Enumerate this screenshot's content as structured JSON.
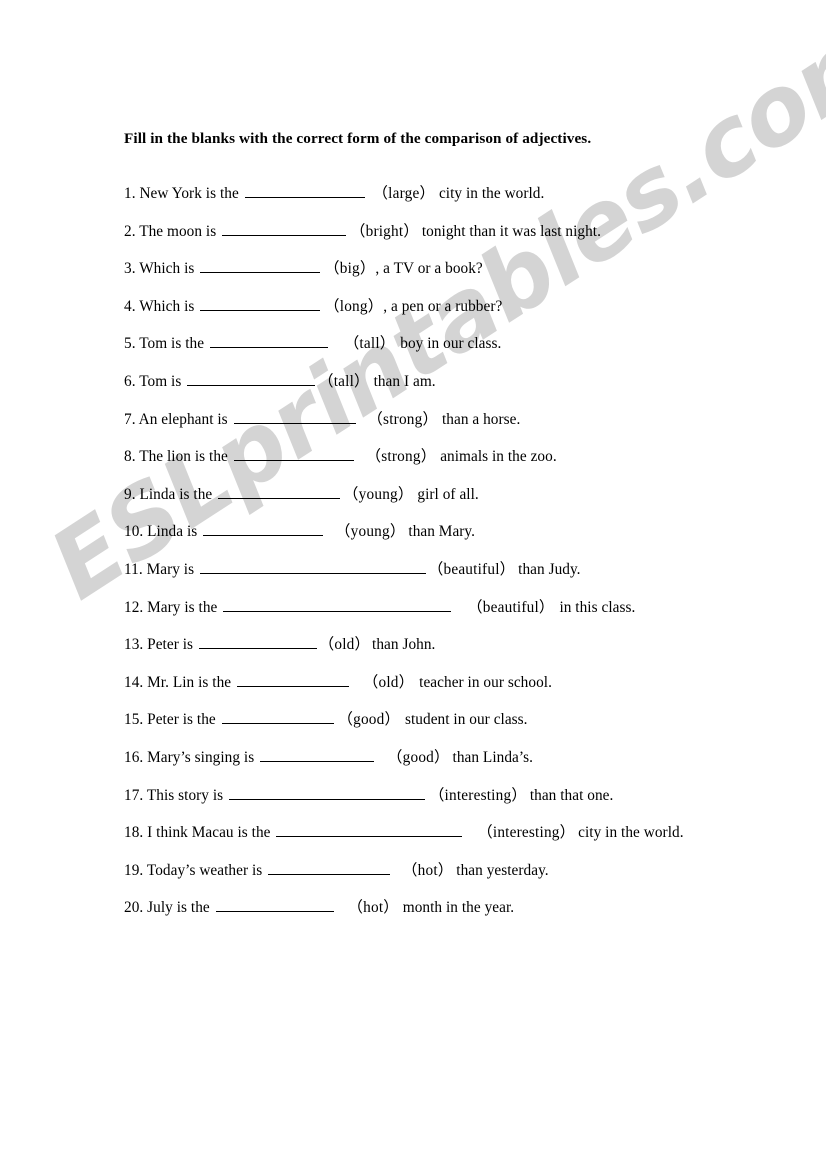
{
  "document": {
    "title_line": "Fill in the blanks with the correct form of the comparison of adjectives.",
    "watermark": "ESLprintables.com",
    "watermark_color": "#d4d4d4",
    "page_background": "#ffffff",
    "text_color": "#000000"
  },
  "questions": [
    {
      "number": "1.",
      "pre": "New York is the",
      "blank_width": 120,
      "hint": "（large）",
      "post": "city in the world.",
      "gap_before_hint": 6,
      "gap_after_hint": 4
    },
    {
      "number": "2.",
      "pre": "The moon is",
      "blank_width": 124,
      "hint": "（bright）",
      "post": "tonight than it was last night.",
      "gap_before_hint": 2,
      "gap_after_hint": 3
    },
    {
      "number": "3.",
      "pre": "Which is",
      "blank_width": 120,
      "hint": "（big）",
      "post": ", a TV or a book?",
      "gap_before_hint": 2,
      "gap_after_hint": 0
    },
    {
      "number": "4.",
      "pre": "Which is",
      "blank_width": 120,
      "hint": "（long）",
      "post": ", a pen or a rubber?",
      "gap_before_hint": 2,
      "gap_after_hint": 0
    },
    {
      "number": "5.",
      "pre": "Tom is the",
      "blank_width": 118,
      "hint": "（tall）",
      "post": "boy in our class.",
      "gap_before_hint": 14,
      "gap_after_hint": 5
    },
    {
      "number": "6.",
      "pre": "Tom is",
      "blank_width": 128,
      "hint": "（tall）",
      "post": "than I am.",
      "gap_before_hint": 1,
      "gap_after_hint": 4
    },
    {
      "number": "7.",
      "pre": "An elephant is",
      "blank_width": 122,
      "hint": "（strong）",
      "post": "than a horse.",
      "gap_before_hint": 10,
      "gap_after_hint": 4
    },
    {
      "number": "8.",
      "pre": "The lion is the",
      "blank_width": 120,
      "hint": "（strong）",
      "post": "animals in the zoo.",
      "gap_before_hint": 10,
      "gap_after_hint": 4
    },
    {
      "number": "9.",
      "pre": "Linda is the",
      "blank_width": 122,
      "hint": "（young）",
      "post": "girl of all.",
      "gap_before_hint": 1,
      "gap_after_hint": 4
    },
    {
      "number": "10.",
      "pre": "Linda is",
      "blank_width": 120,
      "hint": "（young）",
      "post": "than Mary.",
      "gap_before_hint": 10,
      "gap_after_hint": 3
    },
    {
      "number": "11.",
      "pre": "Mary is",
      "blank_width": 226,
      "hint": "（beautiful）",
      "post": "than Judy.",
      "gap_before_hint": 0,
      "gap_after_hint": 3
    },
    {
      "number": "12.",
      "pre": "Mary is the",
      "blank_width": 228,
      "hint": "（beautiful）",
      "post": "in this class.",
      "gap_before_hint": 14,
      "gap_after_hint": 5
    },
    {
      "number": "13.",
      "pre": "Peter is",
      "blank_width": 118,
      "hint": "（old）",
      "post": "than John.",
      "gap_before_hint": 0,
      "gap_after_hint": 2
    },
    {
      "number": "14.",
      "pre": "Mr. Lin is the",
      "blank_width": 112,
      "hint": "（old）",
      "post": "teacher in our school.",
      "gap_before_hint": 12,
      "gap_after_hint": 5
    },
    {
      "number": "15.",
      "pre": "Peter is the",
      "blank_width": 112,
      "hint": "（good）",
      "post": "student in our class.",
      "gap_before_hint": 2,
      "gap_after_hint": 5
    },
    {
      "number": "16.",
      "pre": "Mary’s singing is",
      "blank_width": 114,
      "hint": "（good）",
      "post": "than Linda’s.",
      "gap_before_hint": 11,
      "gap_after_hint": 3
    },
    {
      "number": "17.",
      "pre": "This story is",
      "blank_width": 196,
      "hint": "（interesting）",
      "post": "than that one.",
      "gap_before_hint": 2,
      "gap_after_hint": 3
    },
    {
      "number": "18.",
      "pre": "I think Macau is the",
      "blank_width": 186,
      "hint": "（interesting）",
      "post": "city in the world.",
      "gap_before_hint": 13,
      "gap_after_hint": 3
    },
    {
      "number": "19.",
      "pre": "Today’s weather is",
      "blank_width": 122,
      "hint": "（hot）",
      "post": "than yesterday.",
      "gap_before_hint": 10,
      "gap_after_hint": 3
    },
    {
      "number": "20.",
      "pre": "July is the",
      "blank_width": 118,
      "hint": "（hot）",
      "post": "month in the year.",
      "gap_before_hint": 12,
      "gap_after_hint": 4
    }
  ]
}
